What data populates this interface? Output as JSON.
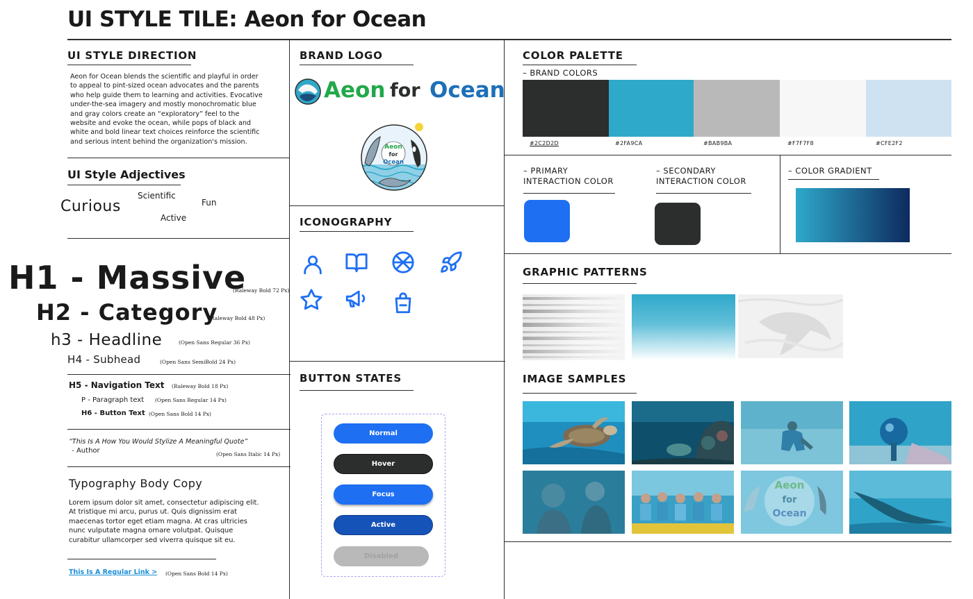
{
  "title": "UI STYLE TILE: Aeon for Ocean",
  "direction": {
    "heading": "UI STYLE DIRECTION",
    "lines": [
      "Aeon for Ocean blends the scientific and playful in order",
      "to appeal to pint-sized ocean advocates and the parents",
      "who help guide them to learning and activities.  Evocative",
      "under-the-sea imagery and mostly monochromatic  blue",
      "and gray colors create an “exploratory” feel to the",
      "website and evoke the ocean, while pops of black and",
      "white and bold linear text choices reinforce the scientific",
      "and serious intent behind the organization's mission."
    ]
  },
  "adjectives": {
    "heading": "UI Style Adjectives",
    "curious": "Curious",
    "scientific": "Scientific",
    "fun": "Fun",
    "active": "Active"
  },
  "typography": {
    "h1": "H1 - Massive",
    "h1_note": "(Raleway Bold 72 Px)",
    "h2": "H2 - Category",
    "h2_note": "(Raleway Bold 48 Px)",
    "h3": "h3 - Headline",
    "h3_note": "(Open Sans Regular 36 Px)",
    "h4": "H4 - Subhead",
    "h4_note": "(Open Sans SemiBold 24 Px)",
    "h5": "H5 - Navigation Text",
    "h5_note": "(Raleway Bold 18 Px)",
    "p": "P - Paragraph text",
    "p_note": "(Open Sans Regular 14 Px)",
    "h6": "H6 - Button Text",
    "h6_note": "(Open Sans Bold 14 Px)",
    "quote": "“This Is A How You Would Stylize A Meaningful Quote”",
    "author": " - Author",
    "quote_note": "(Open Sans Italic 14 Px)",
    "body_heading": "Typography Body Copy",
    "body_lines": [
      "Lorem ipsum dolor sit amet, consectetur adipiscing elit.",
      "At tristique mi arcu, purus ut. Quis dignissim erat",
      "maecenas tortor eget etiam magna. At cras ultricies",
      "nunc vulputate magna ornare volutpat. Quisque",
      "curabitur ullamcorper sed viverra quisque sit eu."
    ],
    "link": "This Is A Regular Link >",
    "link_note": "(Open Sans Bold 14 Px)"
  },
  "brand_logo": {
    "heading": "BRAND LOGO",
    "word_aeon": "Aeon",
    "word_for": "for",
    "word_ocean": "Ocean",
    "badge_aeon": "Aeon",
    "badge_for": "for",
    "badge_ocean": "Ocean"
  },
  "iconography": {
    "heading": "ICONOGRAPHY",
    "icons": [
      "user-icon",
      "book-icon",
      "basketball-icon",
      "rocket-icon",
      "star-icon",
      "megaphone-icon",
      "shopping-bag-icon"
    ]
  },
  "buttons": {
    "heading": "BUTTON STATES",
    "normal": "Normal",
    "hover": "Hover",
    "focus": "Focus",
    "active": "Active",
    "disabled": "Disabled"
  },
  "palette": {
    "heading": "COLOR PALETTE",
    "sub": "– BRAND COLORS",
    "colors": [
      {
        "hex": "#2C2D2D",
        "label": "#2C2D2D"
      },
      {
        "hex": "#2FA9CA",
        "label": "#2FA9CA"
      },
      {
        "hex": "#BAB9BA",
        "label": "#BAB9BA"
      },
      {
        "hex": "#F7F7F8",
        "label": "#F7F7F8"
      },
      {
        "hex": "#CFE2F2",
        "label": "#CFE2F2"
      }
    ]
  },
  "interaction": {
    "primary_line1": "– PRIMARY",
    "primary_line2": "INTERACTION COLOR",
    "primary_color": "#1E6FF2",
    "secondary_line1": "– SECONDARY",
    "secondary_line2": "INTERACTION COLOR",
    "secondary_color": "#2C2D2D",
    "gradient_label": "– COLOR GRADIENT",
    "gradient_from": "#2FA9CA",
    "gradient_to": "#0D2A5E"
  },
  "patterns": {
    "heading": "GRAPHIC PATTERNS"
  },
  "samples": {
    "heading": "IMAGE SAMPLES"
  }
}
